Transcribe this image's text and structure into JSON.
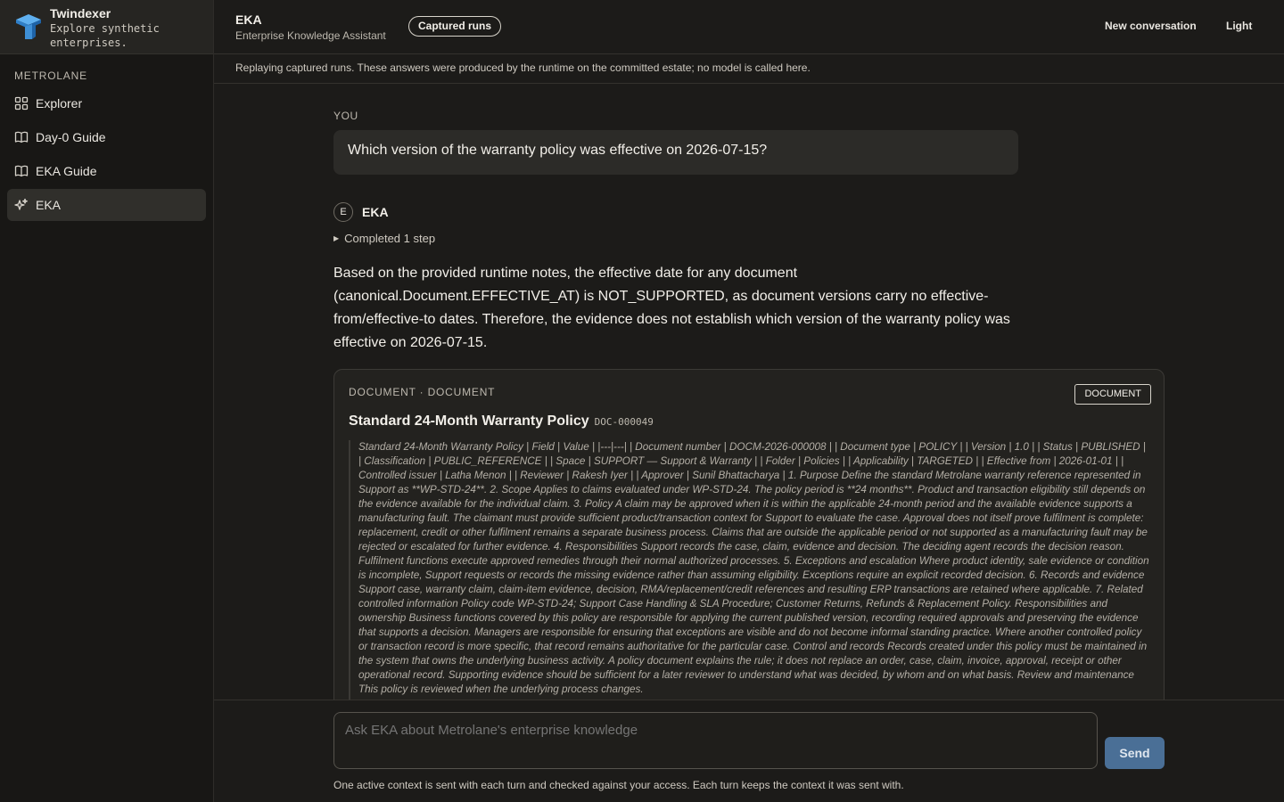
{
  "brand": {
    "name": "Twindexer",
    "tagline": "Explore synthetic enterprises."
  },
  "sidebar": {
    "section_label": "METROLANE",
    "items": [
      {
        "label": "Explorer",
        "icon": "grid-icon",
        "active": false
      },
      {
        "label": "Day-0 Guide",
        "icon": "book-open-icon",
        "active": false
      },
      {
        "label": "EKA Guide",
        "icon": "book-open-icon",
        "active": false
      },
      {
        "label": "EKA",
        "icon": "sparkles-icon",
        "active": true
      }
    ]
  },
  "header": {
    "title": "EKA",
    "subtitle": "Enterprise Knowledge Assistant",
    "badge": "Captured runs",
    "new_conversation": "New conversation",
    "theme_toggle": "Light"
  },
  "notice": "Replaying captured runs. These answers were produced by the runtime on the committed estate; no model is called here.",
  "conversation": {
    "user_label": "YOU",
    "question": "Which version of the warranty policy was effective on 2026-07-15?",
    "assistant_avatar": "E",
    "assistant_name": "EKA",
    "steps_label": "Completed 1 step",
    "answer": "Based on the provided runtime notes, the effective date for any document (canonical.Document.EFFECTIVE_AT) is NOT_SUPPORTED, as document versions carry no effective-from/effective-to dates. Therefore, the evidence does not establish which version of the warranty policy was effective on 2026-07-15."
  },
  "document_card": {
    "kicker": "DOCUMENT · DOCUMENT",
    "badge": "DOCUMENT",
    "title": "Standard 24-Month Warranty Policy",
    "doc_id": "DOC-000049",
    "excerpt": "Standard 24-Month Warranty Policy | Field | Value | |---|---| | Document number | DOCM-2026-000008 | | Document type | POLICY | | Version | 1.0 | | Status | PUBLISHED | | Classification | PUBLIC_REFERENCE | | Space | SUPPORT — Support & Warranty | | Folder | Policies | | Applicability | TARGETED | | Effective from | 2026-01-01 | | Controlled issuer | Latha Menon | | Reviewer | Rakesh Iyer | | Approver | Sunil Bhattacharya | 1. Purpose Define the standard Metrolane warranty reference represented in Support as **WP-STD-24**. 2. Scope Applies to claims evaluated under WP-STD-24. The policy period is **24 months**. Product and transaction eligibility still depends on the evidence available for the individual claim. 3. Policy A claim may be approved when it is within the applicable 24-month period and the available evidence supports a manufacturing fault. The claimant must provide sufficient product/transaction context for Support to evaluate the case. Approval does not itself prove fulfilment is complete: replacement, credit or other fulfilment remains a separate business process. Claims that are outside the applicable period or not supported as a manufacturing fault may be rejected or escalated for further evidence. 4. Responsibilities Support records the case, claim, evidence and decision. The deciding agent records the decision reason. Fulfilment functions execute approved remedies through their normal authorized processes. 5. Exceptions and escalation Where product identity, sale evidence or condition is incomplete, Support requests or records the missing evidence rather than assuming eligibility. Exceptions require an explicit recorded decision. 6. Records and evidence Support case, warranty claim, claim-item evidence, decision, RMA/replacement/credit references and resulting ERP transactions are retained where applicable. 7. Related controlled information Policy code WP-STD-24; Support Case Handling & SLA Procedure; Customer Returns, Refunds & Replacement Policy. Responsibilities and ownership Business functions covered by this policy are responsible for applying the current published version, recording required approvals and preserving the evidence that supports a decision. Managers are responsible for ensuring that exceptions are visible and do not become informal standing practice. Where another controlled policy or transaction record is more specific, that record remains authoritative for the particular case. Control and records Records created under this policy must be maintained in the system that owns the underlying business activity. A policy document explains the rule; it does not replace an order, case, claim, invoice, approval, receipt or other operational record. Supporting evidence should be sufficient for a later reviewer to understand what was decided, by whom and on what basis. Review and maintenance This policy is reviewed when the underlying process changes."
  },
  "composer": {
    "placeholder": "Ask EKA about Metrolane's enterprise knowledge",
    "send_label": "Send",
    "footnote": "One active context is sent with each turn and checked against your access. Each turn keeps the context it was sent with."
  },
  "colors": {
    "background": "#1c1b19",
    "sidebar": "#181715",
    "accent_send": "#4a6f96",
    "brand_logo": "#3e8fd6"
  }
}
